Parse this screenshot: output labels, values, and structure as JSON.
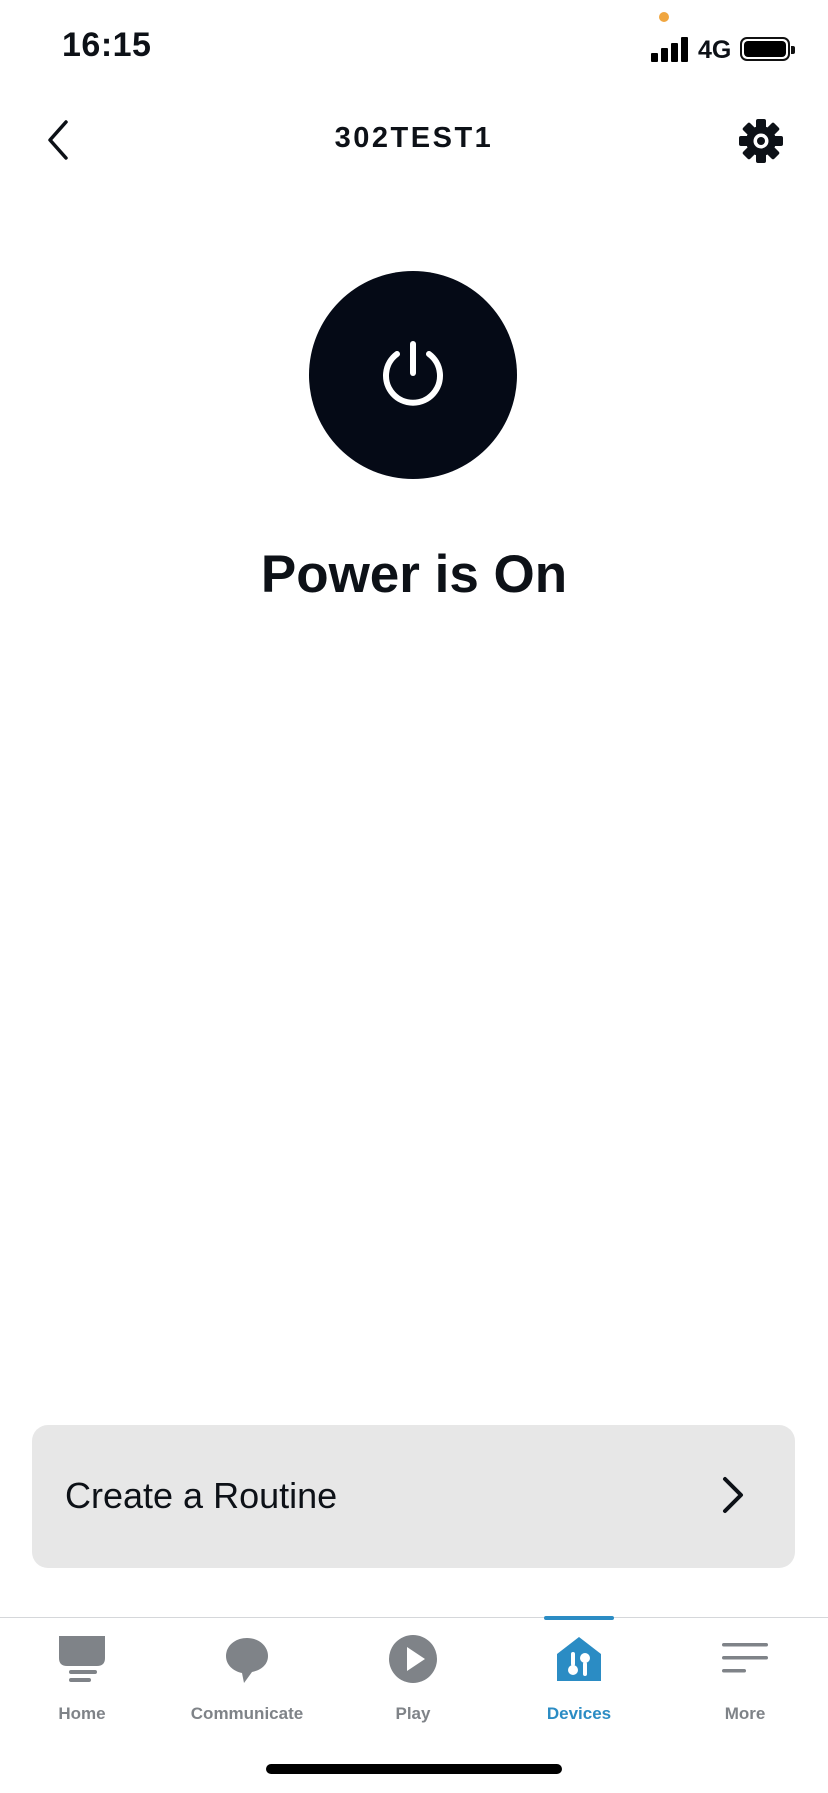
{
  "status_bar": {
    "time": "16:15",
    "network": "4G",
    "privacy_dot_color": "#f0a640"
  },
  "header": {
    "title": "302TEST1",
    "back_icon": "chevron-left-icon",
    "settings_icon": "gear-icon"
  },
  "device": {
    "power_icon": "power-icon",
    "state_text": "Power is On"
  },
  "routine": {
    "label": "Create a Routine",
    "chevron_icon": "chevron-right-icon"
  },
  "tabs": [
    {
      "label": "Home",
      "icon": "home-icon",
      "active": false
    },
    {
      "label": "Communicate",
      "icon": "chat-bubble-icon",
      "active": false
    },
    {
      "label": "Play",
      "icon": "play-icon",
      "active": false
    },
    {
      "label": "Devices",
      "icon": "devices-icon",
      "active": true
    },
    {
      "label": "More",
      "icon": "menu-icon",
      "active": false
    }
  ],
  "colors": {
    "accent": "#2b8cc4",
    "power_button": "#050a16",
    "card": "#e7e7e7",
    "inactive_tab": "#7f8388"
  }
}
